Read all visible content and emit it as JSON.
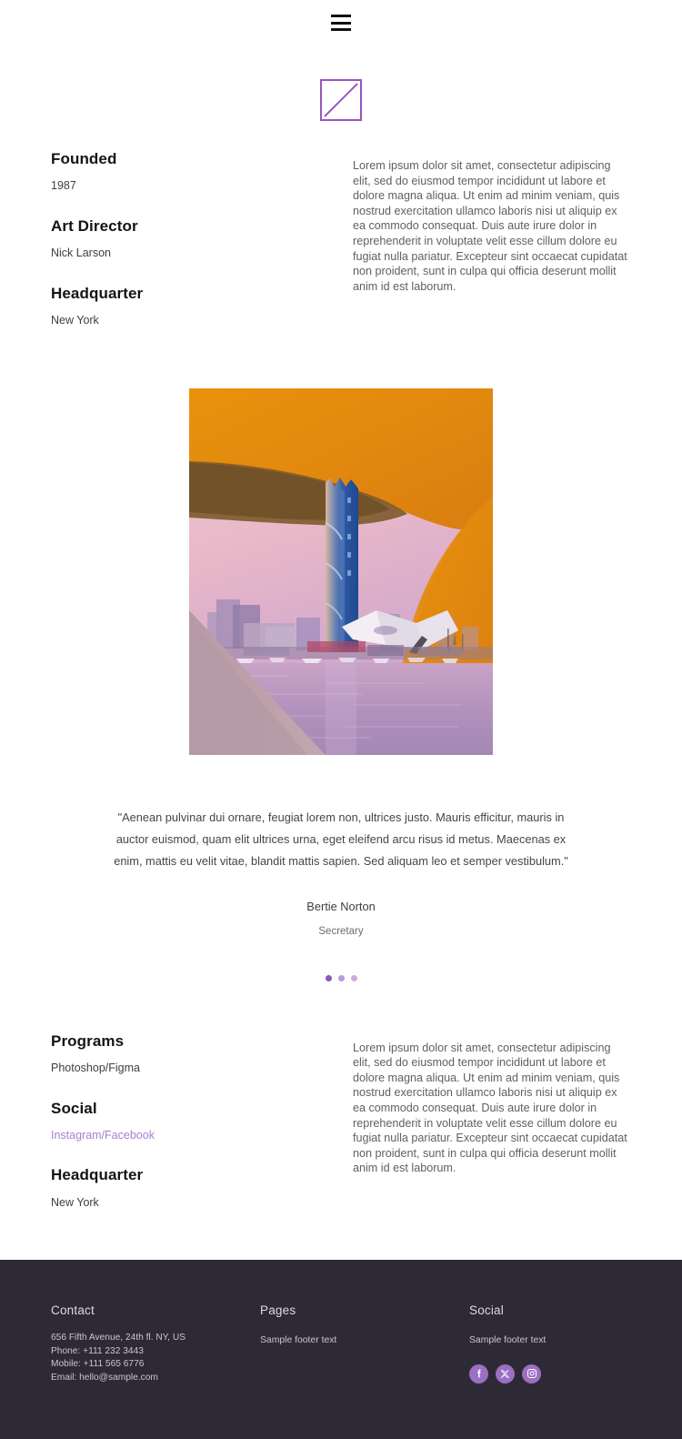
{
  "header": {
    "menu_icon": "hamburger-icon"
  },
  "logo": {
    "icon": "diagonal-square-logo",
    "color": "#9457c0"
  },
  "about": {
    "blocks": [
      {
        "title": "Founded",
        "value": "1987"
      },
      {
        "title": "Art Director",
        "value": "Nick Larson"
      },
      {
        "title": "Headquarter",
        "value": "New York"
      }
    ],
    "paragraph": "Lorem ipsum dolor sit amet, consectetur adipiscing elit, sed do eiusmod tempor incididunt ut labore et dolore magna aliqua. Ut enim ad minim veniam, quis nostrud exercitation ullamco laboris nisi ut aliquip ex ea commodo consequat. Duis aute irure dolor in reprehenderit in voluptate velit esse cillum dolore eu fugiat nulla pariatur. Excepteur sint occaecat cupidatat non proident, sunt in culpa qui officia deserunt mollit anim id est laborum."
  },
  "photo": {
    "alt": "waterfront-cityscape-at-sunset",
    "arch_color": "#e08a12",
    "sky_color": "#e7b7c6",
    "tower_color": "#2f5fa8"
  },
  "testimonial": {
    "quote": "\"Aenean pulvinar dui ornare, feugiat lorem non, ultrices justo. Mauris efficitur, mauris in auctor euismod, quam elit ultrices urna, eget eleifend arcu risus id metus. Maecenas ex enim, mattis eu velit vitae, blandit mattis sapien. Sed aliquam leo et semper vestibulum.\"",
    "author": "Bertie Norton",
    "role": "Secretary",
    "dots": [
      {
        "state": "active"
      },
      {
        "state": "mid"
      },
      {
        "state": "inactive"
      }
    ]
  },
  "details": {
    "blocks": [
      {
        "title": "Programs",
        "value": "Photoshop/Figma",
        "is_link": false
      },
      {
        "title": "Social",
        "value": "Instagram/Facebook",
        "is_link": true
      },
      {
        "title": "Headquarter",
        "value": "New York",
        "is_link": false
      }
    ],
    "paragraph": "Lorem ipsum dolor sit amet, consectetur adipiscing elit, sed do eiusmod tempor incididunt ut labore et dolore magna aliqua. Ut enim ad minim veniam, quis nostrud exercitation ullamco laboris nisi ut aliquip ex ea commodo consequat. Duis aute irure dolor in reprehenderit in voluptate velit esse cillum dolore eu fugiat nulla pariatur. Excepteur sint occaecat cupidatat non proident, sunt in culpa qui officia deserunt mollit anim id est laborum.",
    "link_color": "#a77fd0"
  },
  "footer": {
    "background": "#2e2a35",
    "contact": {
      "title": "Contact",
      "address": "656 Fifth Avenue, 24th fl. NY, US",
      "phone": "Phone: +111 232 3443",
      "mobile": "Mobile: +111 565 6776",
      "email": "Email: hello@sample.com"
    },
    "pages": {
      "title": "Pages",
      "text": "Sample footer text"
    },
    "social": {
      "title": "Social",
      "text": "Sample footer text",
      "icons": [
        "facebook-icon",
        "x-twitter-icon",
        "instagram-icon"
      ],
      "icon_color": "#9a6fc4"
    }
  }
}
